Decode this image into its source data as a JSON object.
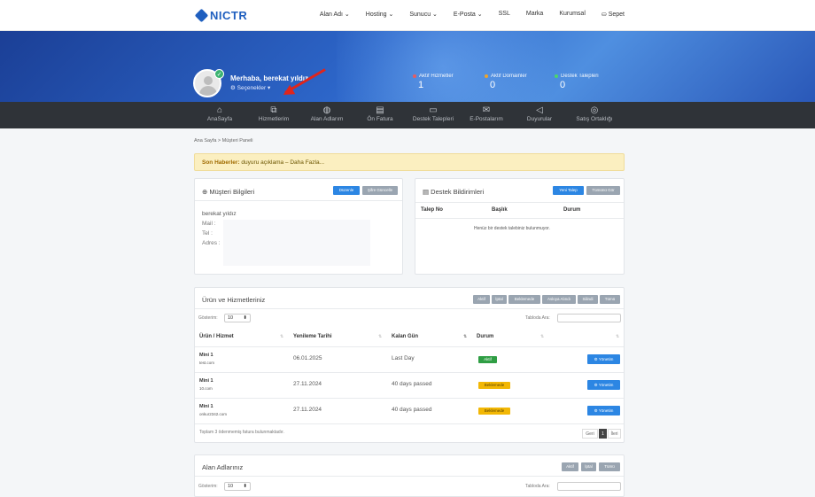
{
  "brand": {
    "logo_text": "NICTR"
  },
  "top_nav": {
    "items": [
      "Alan Adı ⌄",
      "Hosting ⌄",
      "Sunucu ⌄",
      "E-Posta ⌄",
      "SSL",
      "Marka",
      "Kurumsal",
      "⛀ Sepet"
    ]
  },
  "hero": {
    "greeting": "Merhaba, berekat yıldız",
    "options": "⚙ Seçenekler ▾",
    "stats": [
      {
        "label": "Aktif Hizmetler",
        "value": "1",
        "color": "#f05a5a"
      },
      {
        "label": "Aktif Domainler",
        "value": "0",
        "color": "#f5a623"
      },
      {
        "label": "Destek Talepleri",
        "value": "0",
        "color": "#4cd964"
      }
    ]
  },
  "main_nav": {
    "items": [
      {
        "label": "AnaSayfa",
        "icon": "home-icon"
      },
      {
        "label": "Hizmetlerim",
        "icon": "copy-icon"
      },
      {
        "label": "Alan Adlarım",
        "icon": "globe-icon"
      },
      {
        "label": "Ön Fatura",
        "icon": "document-icon"
      },
      {
        "label": "Destek Talepleri",
        "icon": "chat-icon"
      },
      {
        "label": "E-Postalarım",
        "icon": "envelope-icon"
      },
      {
        "label": "Duyurular",
        "icon": "megaphone-icon"
      },
      {
        "label": "Satış Ortaklığı",
        "icon": "target-icon"
      }
    ]
  },
  "breadcrumb": "Ana Sayfa > Müşteri Paneli",
  "news": {
    "bold": "Son Haberler:",
    "text": " duyuru açıklama – Daha Fazla..."
  },
  "customer": {
    "title": "⊕ Müşteri Bilgileri",
    "edit_btn": "Düzenle",
    "password_btn": "Şifre Güncelle",
    "name": "berekat yıldız",
    "mail_label": "Mail :",
    "tel_label": "Tel :",
    "address_label": "Adres :"
  },
  "support": {
    "title": "▤ Destek Bildirimleri",
    "new_btn": "Yeni Talep",
    "all_btn": "Tümünü Gör",
    "headers": [
      "Talep No",
      "Başlık",
      "Durum"
    ],
    "empty": "Henüz bir destek talebiniz bulunmuyor."
  },
  "products": {
    "title": "Ürün ve Hizmetleriniz",
    "filters": [
      "Aktif",
      "İptal",
      "Beklemede",
      "Askıya Alındı",
      "Silindi",
      "Tümü"
    ],
    "show_label": "Gösterim:",
    "show_value": "10",
    "search_label": "Tabloda Ara:",
    "headers": [
      "Ürün / Hizmet",
      "Yenileme Tarihi",
      "Kalan Gün",
      "Durum"
    ],
    "rows": [
      {
        "product": "Mini 1",
        "domain": "test.com",
        "date": "06.01.2025",
        "days": "Last Day",
        "status": "Aktif",
        "status_color": "#2f9e44",
        "action": "⚙ Yönetim"
      },
      {
        "product": "Mini 1",
        "domain": "10.com",
        "date": "27.11.2024",
        "days": "40 days passed",
        "status": "Beklemede",
        "status_color": "#f2b705",
        "action": "⚙ Yönetim"
      },
      {
        "product": "Mini 1",
        "domain": "onkur2342.com",
        "date": "27.11.2024",
        "days": "40 days passed",
        "status": "Beklemede",
        "status_color": "#f2b705",
        "action": "⚙ Yönetim"
      }
    ],
    "footer": "Toplam 3 ödenmemiş fatura bulunmaktadır.",
    "pager": [
      "Geri",
      "1",
      "İleri"
    ]
  },
  "domains": {
    "title": "Alan Adlarınız",
    "filters": [
      "Aktif",
      "İptal",
      "Tümü"
    ],
    "show_label": "Gösterim:",
    "show_value": "10",
    "search_label": "Tabloda Ara:"
  }
}
